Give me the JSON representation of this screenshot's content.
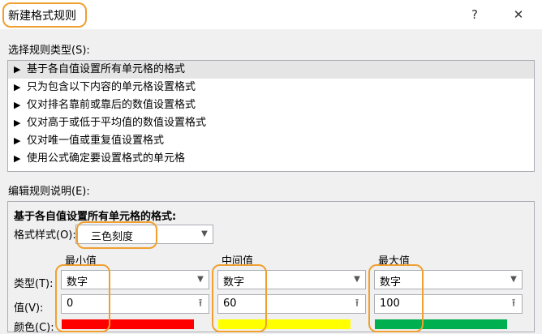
{
  "window": {
    "title": "新建格式规则",
    "help_glyph": "?",
    "close_glyph": "✕"
  },
  "rule_types": {
    "label": "选择规则类型(S):",
    "items": [
      "基于各自值设置所有单元格的格式",
      "只为包含以下内容的单元格设置格式",
      "仅对排名靠前或靠后的数值设置格式",
      "仅对高于或低于平均值的数值设置格式",
      "仅对唯一值或重复值设置格式",
      "使用公式确定要设置格式的单元格"
    ]
  },
  "edit": {
    "label": "编辑规则说明(E):",
    "heading": "基于各自值设置所有单元格的格式:",
    "format_style_label": "格式样式(O):",
    "format_style_value": "三色刻度",
    "type_label": "类型(T):",
    "value_label": "值(V):",
    "color_label": "颜色(C):",
    "columns": [
      {
        "heading": "最小值",
        "type": "数字",
        "value": "0",
        "color": "#ff0000"
      },
      {
        "heading": "中间值",
        "type": "数字",
        "value": "60",
        "color": "#ffff00"
      },
      {
        "heading": "最大值",
        "type": "数字",
        "value": "100",
        "color": "#00b050"
      }
    ]
  },
  "icons": {
    "dropdown": "chevron-down-icon",
    "range_picker": "range-picker-icon",
    "arrow": "triangle-right-icon"
  }
}
